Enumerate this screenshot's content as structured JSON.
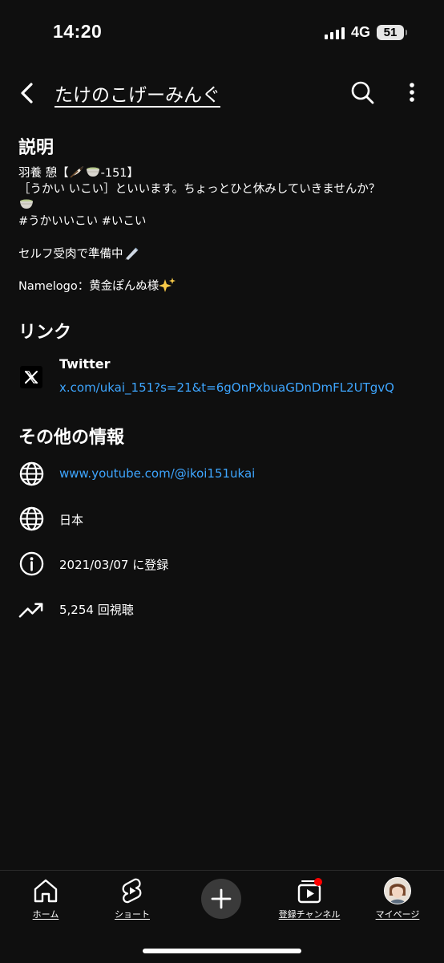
{
  "status_bar": {
    "time": "14:20",
    "network": "4G",
    "battery": "51"
  },
  "header": {
    "title": "たけのこげーみんぐ"
  },
  "description": {
    "heading": "説明",
    "line1_prefix": "羽養 憩【",
    "line1_suffix": "-151】",
    "line2": "［うかい いこい］といいます。ちょっとひと休みしていきませんか？",
    "line4": "#うかいいこい  #いこい",
    "line6": "セルフ受肉で準備中",
    "line8": "Namelogo：黄金ぽんぬ様"
  },
  "links": {
    "heading": "リンク",
    "items": [
      {
        "title": "Twitter",
        "url": "x.com/ukai_151?s=21&t=6gOnPxbuaGDnDmFL2UTgvQ",
        "icon": "x-logo-icon"
      }
    ]
  },
  "other_info": {
    "heading": "その他の情報",
    "channel_url": "www.youtube.com/@ikoi151ukai",
    "country": "日本",
    "joined": "2021/03/07 に登録",
    "views": "5,254 回視聴"
  },
  "bottom_nav": {
    "items": [
      {
        "label": "ホーム",
        "icon": "home-icon"
      },
      {
        "label": "ショート",
        "icon": "shorts-icon"
      },
      {
        "label": "",
        "icon": "plus-icon"
      },
      {
        "label": "登録チャンネル",
        "icon": "subscriptions-icon"
      },
      {
        "label": "マイページ",
        "icon": "avatar"
      }
    ]
  },
  "colors": {
    "background": "#0f0f0f",
    "link": "#3ea6ff",
    "text": "#ffffff",
    "notification_dot": "#ff0000"
  }
}
